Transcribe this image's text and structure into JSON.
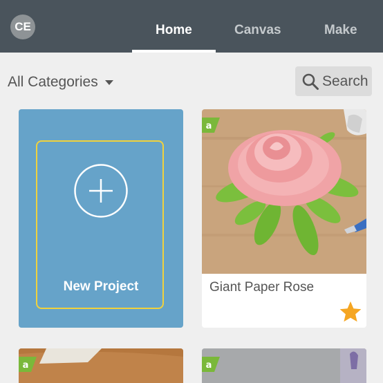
{
  "header": {
    "avatar_initials": "CE",
    "tabs": [
      {
        "label": "Home",
        "active": true
      },
      {
        "label": "Canvas",
        "active": false
      },
      {
        "label": "Make",
        "active": false
      }
    ]
  },
  "toolbar": {
    "category_filter": "All Categories",
    "search_label": "Search"
  },
  "projects": {
    "new_project_label": "New Project",
    "items": [
      {
        "title": "Giant Paper Rose",
        "favorite": true,
        "access_badge": "a"
      }
    ]
  },
  "colors": {
    "topbar": "#4a545c",
    "new_project_card": "#66a3c9",
    "new_project_frame": "#f1d23c",
    "access_badge": "#7ab83a",
    "favorite_star": "#f5a623"
  }
}
